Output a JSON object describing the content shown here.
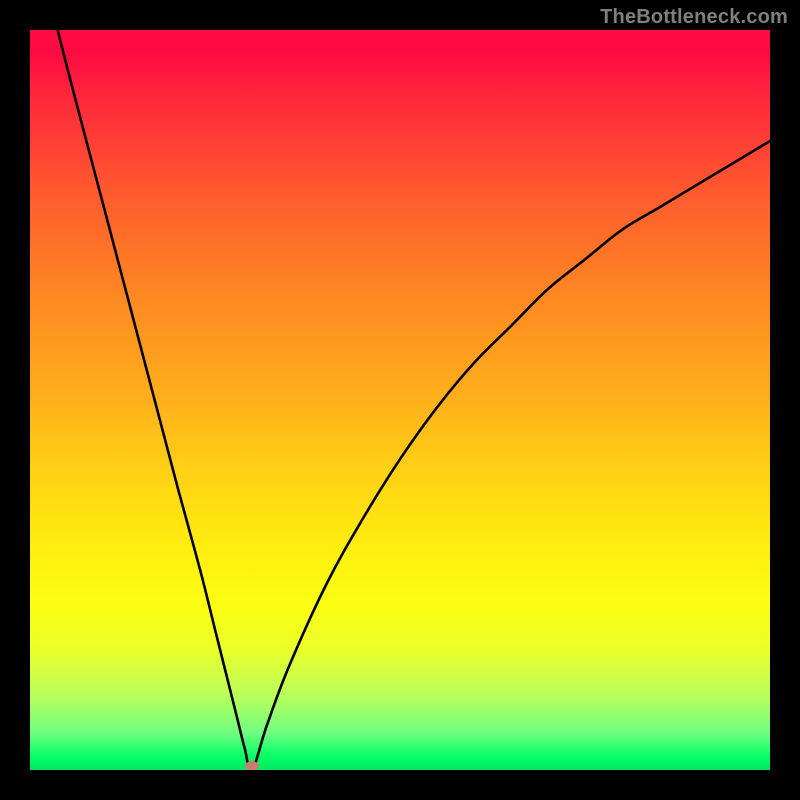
{
  "watermark": "TheBottleneck.com",
  "chart_data": {
    "type": "line",
    "title": "",
    "xlabel": "",
    "ylabel": "",
    "xlim": [
      0,
      100
    ],
    "ylim": [
      0,
      100
    ],
    "grid": false,
    "legend": false,
    "series": [
      {
        "name": "bottleneck-curve",
        "x": [
          0,
          5,
          10,
          15,
          20,
          23,
          25,
          27,
          28,
          29,
          30,
          32,
          35,
          40,
          45,
          50,
          55,
          60,
          65,
          70,
          75,
          80,
          85,
          90,
          95,
          100
        ],
        "y": [
          115,
          95,
          76,
          57,
          38,
          27,
          19,
          11,
          7,
          3,
          0,
          6,
          14,
          25,
          34,
          42,
          49,
          55,
          60,
          65,
          69,
          73,
          76,
          79,
          82,
          85
        ]
      }
    ],
    "min_point": {
      "x": 30,
      "y": 0
    },
    "gradient_colors": {
      "top": "#ff0b42",
      "mid": "#ffee0e",
      "bottom": "#01e85e"
    },
    "frame_color": "#000000",
    "curve_color": "#000000",
    "dot_color": "#c97c6e"
  }
}
